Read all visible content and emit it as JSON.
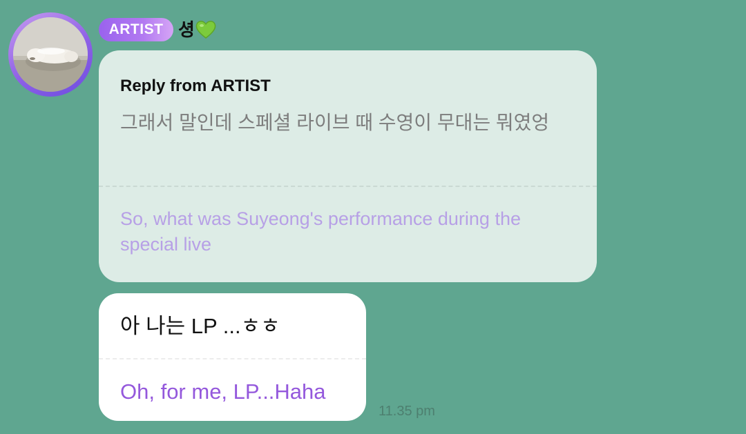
{
  "sender": {
    "badge_label": "ARTIST",
    "name": "셩",
    "name_emoji": "green-heart-icon"
  },
  "reply": {
    "title": "Reply from ARTIST",
    "original_text": "그래서 말인데 스페셜 라이브 때 수영이 무대는 뭐였엉",
    "translation": "So, what was Suyeong's performance during the special live"
  },
  "message": {
    "text": "아 나는 LP ...ㅎㅎ",
    "translation": "Oh, for me, LP...Haha",
    "timestamp": "11.35 pm"
  },
  "colors": {
    "background": "#5fa690",
    "reply_bubble": "#ddece6",
    "badge": "#9a62ee",
    "translation_accent": "#9458dc"
  }
}
